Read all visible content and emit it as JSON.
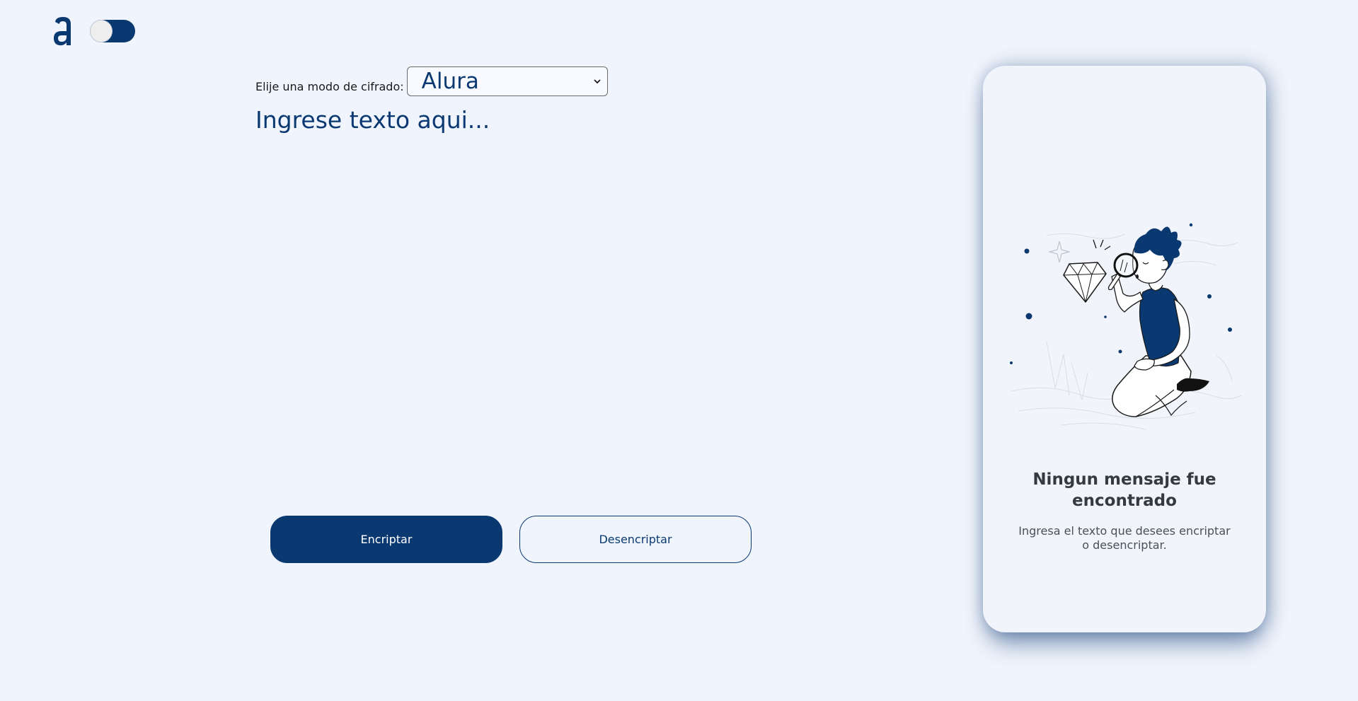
{
  "header": {
    "logo_icon": "alura-logo-icon",
    "theme_toggle": {
      "state": "off",
      "color": "#0a3871"
    }
  },
  "cipher": {
    "label": "Elije una modo de cifrado:",
    "selected": "Alura"
  },
  "input": {
    "placeholder": "Ingrese texto aqui..."
  },
  "actions": {
    "encrypt_label": "Encriptar",
    "decrypt_label": "Desencriptar"
  },
  "result": {
    "illustration_icon": "person-with-magnifying-glass-illustration",
    "title": "Ningun mensaje fue encontrado",
    "subtitle": "Ingresa el texto que desees encriptar o desencriptar."
  },
  "colors": {
    "background": "#f0f4fc",
    "accent": "#0a3871",
    "panel": "#f1f4fb"
  }
}
